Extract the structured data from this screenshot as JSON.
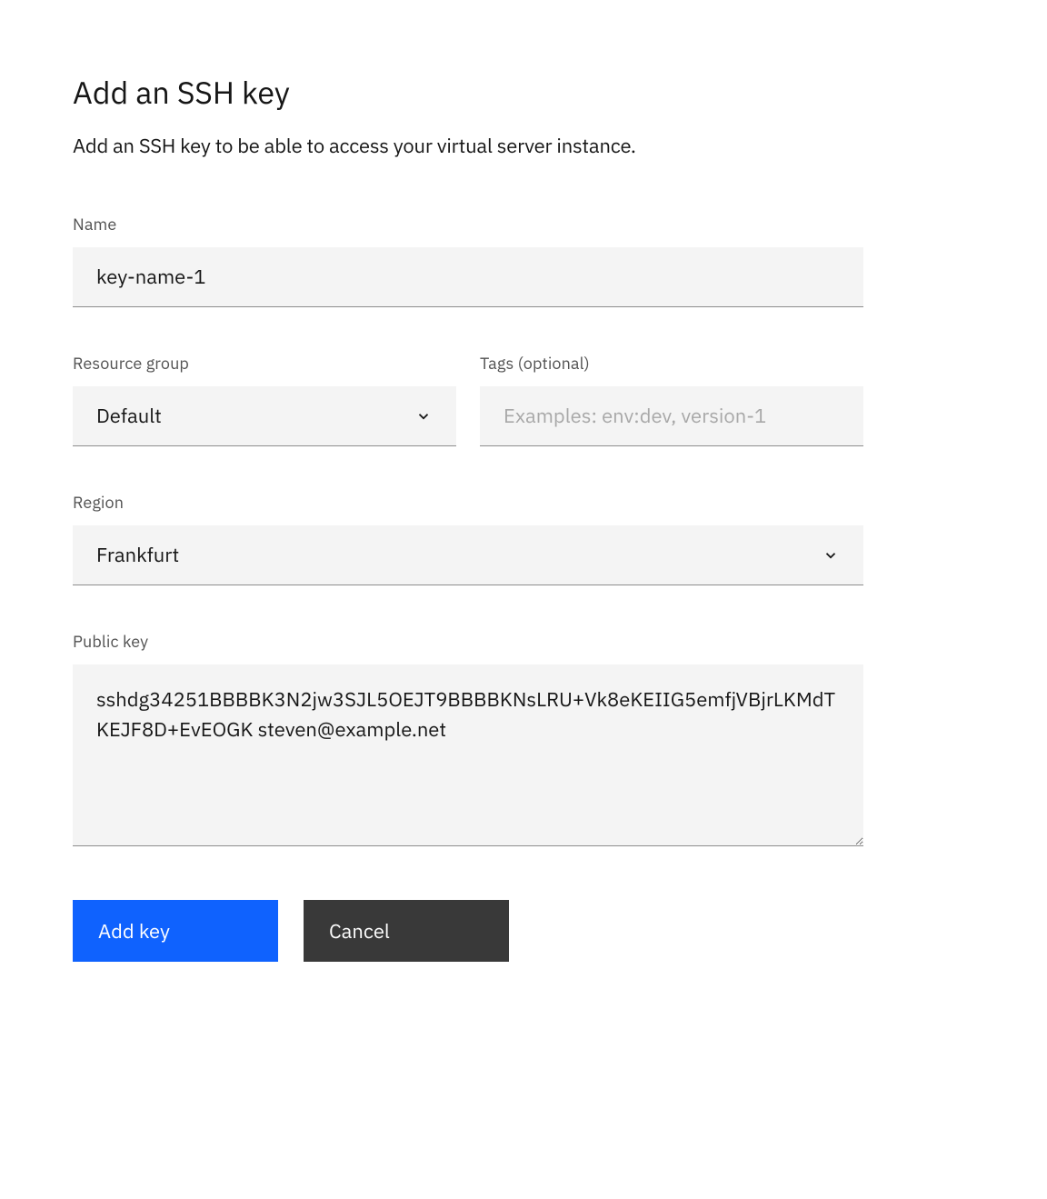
{
  "page": {
    "title": "Add an SSH key",
    "subtitle": "Add an SSH key to be able to access your virtual server instance."
  },
  "fields": {
    "name": {
      "label": "Name",
      "value": "key-name-1"
    },
    "resource_group": {
      "label": "Resource group",
      "value": "Default"
    },
    "tags": {
      "label": "Tags (optional)",
      "value": "",
      "placeholder": "Examples: env:dev, version-1"
    },
    "region": {
      "label": "Region",
      "value": "Frankfurt"
    },
    "public_key": {
      "label": "Public key",
      "value": "sshdg34251BBBBK3N2jw3SJL5OEJT9BBBBKNsLRU+Vk8eKEIIG5emfjVBjrLKMdTKEJF8D+EvEOGK steven@example.net"
    }
  },
  "actions": {
    "primary": "Add key",
    "secondary": "Cancel"
  }
}
